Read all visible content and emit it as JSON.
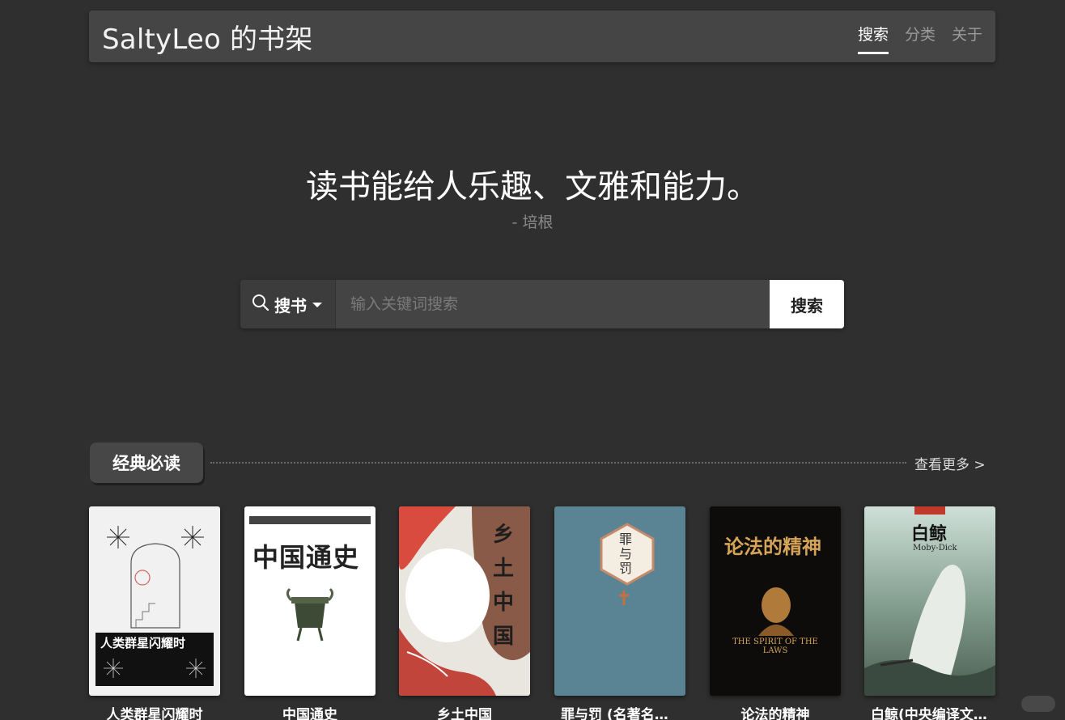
{
  "header": {
    "title": "SaltyLeo 的书架",
    "nav": [
      {
        "label": "搜索",
        "active": true
      },
      {
        "label": "分类",
        "active": false
      },
      {
        "label": "关于",
        "active": false
      }
    ]
  },
  "quote": {
    "text": "读书能给人乐趣、文雅和能力。",
    "author": "- 培根"
  },
  "search": {
    "type_label": "搜书",
    "placeholder": "输入关键词搜索",
    "value": "",
    "button_label": "搜索"
  },
  "section": {
    "title": "经典必读",
    "more_label": "查看更多 >"
  },
  "books": [
    {
      "title": "人类群星闪耀时",
      "cover_text": "人类群星闪耀时"
    },
    {
      "title": "中国通史",
      "cover_text": "中国通史"
    },
    {
      "title": "乡土中国",
      "cover_text": "乡土中国"
    },
    {
      "title": "罪与罚 (名著名译丛书)",
      "cover_text": "罪与罚"
    },
    {
      "title": "论法的精神",
      "cover_text": "论法的精神",
      "cover_subtitle": "THE SPIRIT OF THE LAWS"
    },
    {
      "title": "白鲸(中央编译文库)",
      "cover_text": "白鲸",
      "cover_subtitle": "Moby-Dick"
    }
  ]
}
